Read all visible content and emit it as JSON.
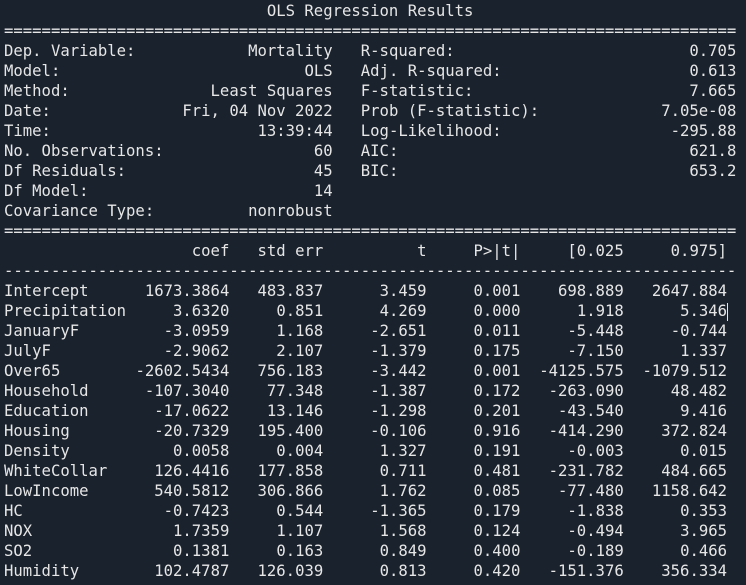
{
  "title": "OLS Regression Results",
  "line_width": 78,
  "header_left": [
    {
      "label": "Dep. Variable:",
      "value": "Mortality"
    },
    {
      "label": "Model:",
      "value": "OLS"
    },
    {
      "label": "Method:",
      "value": "Least Squares"
    },
    {
      "label": "Date:",
      "value": "Fri, 04 Nov 2022"
    },
    {
      "label": "Time:",
      "value": "13:39:44"
    },
    {
      "label": "No. Observations:",
      "value": "60"
    },
    {
      "label": "Df Residuals:",
      "value": "45"
    },
    {
      "label": "Df Model:",
      "value": "14"
    },
    {
      "label": "Covariance Type:",
      "value": "nonrobust"
    }
  ],
  "header_right": [
    {
      "label": "R-squared:",
      "value": "0.705"
    },
    {
      "label": "Adj. R-squared:",
      "value": "0.613"
    },
    {
      "label": "F-statistic:",
      "value": "7.665"
    },
    {
      "label": "Prob (F-statistic):",
      "value": "7.05e-08"
    },
    {
      "label": "Log-Likelihood:",
      "value": "-295.88"
    },
    {
      "label": "AIC:",
      "value": "621.8"
    },
    {
      "label": "BIC:",
      "value": "653.2"
    }
  ],
  "coef_table": {
    "columns": [
      "",
      "coef",
      "std err",
      "t",
      "P>|t|",
      "[0.025",
      "0.975]"
    ],
    "rows": [
      [
        "Intercept",
        "1673.3864",
        "483.837",
        "3.459",
        "0.001",
        "698.889",
        "2647.884"
      ],
      [
        "Precipitation",
        "3.6320",
        "0.851",
        "4.269",
        "0.000",
        "1.918",
        "5.346"
      ],
      [
        "JanuaryF",
        "-3.0959",
        "1.168",
        "-2.651",
        "0.011",
        "-5.448",
        "-0.744"
      ],
      [
        "JulyF",
        "-2.9062",
        "2.107",
        "-1.379",
        "0.175",
        "-7.150",
        "1.337"
      ],
      [
        "Over65",
        "-2602.5434",
        "756.183",
        "-3.442",
        "0.001",
        "-4125.575",
        "-1079.512"
      ],
      [
        "Household",
        "-107.3040",
        "77.348",
        "-1.387",
        "0.172",
        "-263.090",
        "48.482"
      ],
      [
        "Education",
        "-17.0622",
        "13.146",
        "-1.298",
        "0.201",
        "-43.540",
        "9.416"
      ],
      [
        "Housing",
        "-20.7329",
        "195.400",
        "-0.106",
        "0.916",
        "-414.290",
        "372.824"
      ],
      [
        "Density",
        "0.0058",
        "0.004",
        "1.327",
        "0.191",
        "-0.003",
        "0.015"
      ],
      [
        "WhiteCollar",
        "126.4416",
        "177.858",
        "0.711",
        "0.481",
        "-231.782",
        "484.665"
      ],
      [
        "LowIncome",
        "540.5812",
        "306.866",
        "1.762",
        "0.085",
        "-77.480",
        "1158.642"
      ],
      [
        "HC",
        "-0.7423",
        "0.544",
        "-1.365",
        "0.179",
        "-1.838",
        "0.353"
      ],
      [
        "NOX",
        "1.7359",
        "1.107",
        "1.568",
        "0.124",
        "-0.494",
        "3.965"
      ],
      [
        "SO2",
        "0.1381",
        "0.163",
        "0.849",
        "0.400",
        "-0.189",
        "0.466"
      ],
      [
        "Humidity",
        "102.4787",
        "126.039",
        "0.813",
        "0.420",
        "-151.376",
        "356.334"
      ]
    ]
  }
}
